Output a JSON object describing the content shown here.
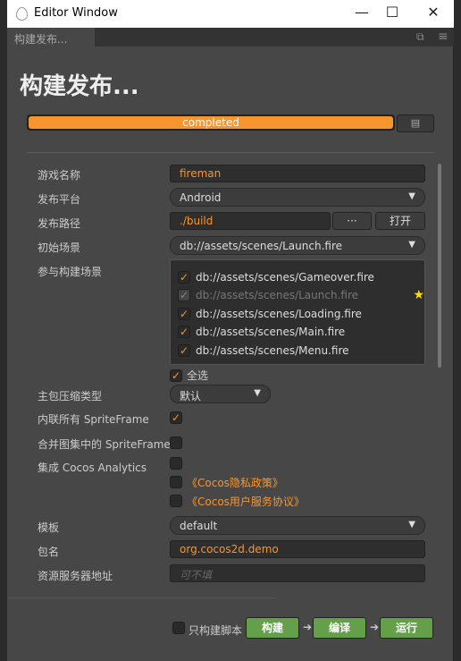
{
  "window": {
    "title": "Editor Window",
    "minimize": "—",
    "maximize": "☐",
    "close": "✕"
  },
  "tab": {
    "label": "构建发布...",
    "popout": "⧉",
    "menu": "≡"
  },
  "heading": "构建发布...",
  "progress": {
    "value": 100,
    "label": "completed",
    "accent": "#f7952e"
  },
  "form": {
    "game_name_label": "游戏名称",
    "game_name": "fireman",
    "platform_label": "发布平台",
    "platform": "Android",
    "path_label": "发布路径",
    "path": "./build",
    "browse": "···",
    "open": "打开",
    "start_scene_label": "初始场景",
    "start_scene": "db://assets/scenes/Launch.fire",
    "scenes_label": "参与构建场景",
    "scenes": [
      {
        "path": "db://assets/scenes/Gameover.fire",
        "checked": true
      },
      {
        "path": "db://assets/scenes/Launch.fire",
        "checked": true,
        "disabled": true,
        "star": "★"
      },
      {
        "path": "db://assets/scenes/Loading.fire",
        "checked": true
      },
      {
        "path": "db://assets/scenes/Main.fire",
        "checked": true
      },
      {
        "path": "db://assets/scenes/Menu.fire",
        "checked": true
      }
    ],
    "select_all": "全选",
    "compress_label": "主包压缩类型",
    "compress": "默认",
    "inline_label": "内联所有 SpriteFrame",
    "merge_label": "合并图集中的 SpriteFrame",
    "analytics_label": "集成 Cocos Analytics",
    "privacy": "《Cocos隐私政策》",
    "service": "《Cocos用户服务协议》",
    "template_label": "模板",
    "template": "default",
    "package_label": "包名",
    "package": "org.cocos2d.demo",
    "server_label": "资源服务器地址",
    "server_placeholder": "可不填"
  },
  "footer": {
    "script_only": "只构建脚本",
    "build": "构建",
    "compile": "编译",
    "run": "运行",
    "arrow": "➔"
  }
}
